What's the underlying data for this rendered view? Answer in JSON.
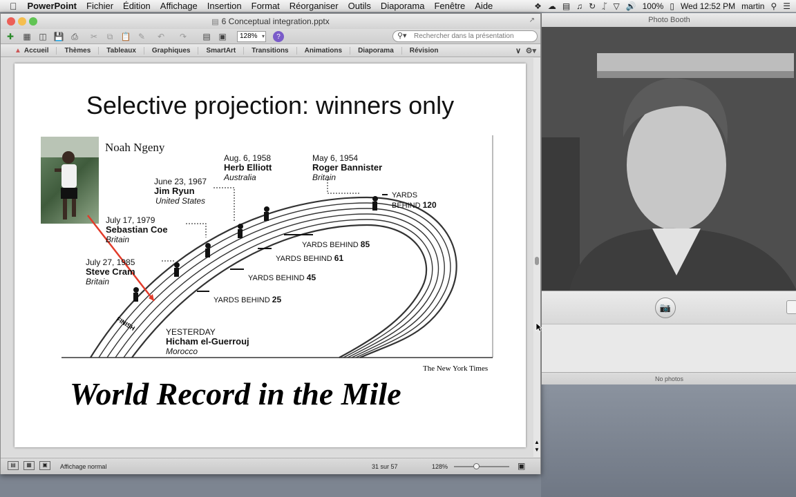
{
  "menubar": {
    "app": "PowerPoint",
    "items": [
      "Fichier",
      "Édition",
      "Affichage",
      "Insertion",
      "Format",
      "Réorganiser",
      "Outils",
      "Diaporama",
      "Fenêtre",
      "Aide"
    ],
    "battery": "100%",
    "clock": "Wed 12:52 PM",
    "user": "martin"
  },
  "ppt": {
    "window_title": "6 Conceptual integration.pptx",
    "zoom_value": "128%",
    "search_placeholder": "Rechercher dans la présentation",
    "ribbon_tabs": [
      "Accueil",
      "Thèmes",
      "Tableaux",
      "Graphiques",
      "SmartArt",
      "Transitions",
      "Animations",
      "Diaporama",
      "Révision"
    ],
    "slide": {
      "title": "Selective projection: winners only",
      "person_caption": "Noah Ngeny",
      "runners": [
        {
          "date": "Aug. 6, 1958",
          "name": "Herb Elliott",
          "country": "Australia"
        },
        {
          "date": "May 6, 1954",
          "name": "Roger Bannister",
          "country": "Britain"
        },
        {
          "date": "June 23, 1967",
          "name": "Jim Ryun",
          "country": "United States"
        },
        {
          "date": "July 17, 1979",
          "name": "Sebastian Coe",
          "country": "Britain"
        },
        {
          "date": "July 27, 1985",
          "name": "Steve Cram",
          "country": "Britain"
        },
        {
          "date": "YESTERDAY",
          "name": "Hicham el-Guerrouj",
          "country": "Morocco"
        }
      ],
      "yards": [
        {
          "label": "YARDS",
          "label2": "BEHIND",
          "value": "120"
        },
        {
          "label": "YARDS BEHIND",
          "value": "85"
        },
        {
          "label": "YARDS BEHIND",
          "value": "61"
        },
        {
          "label": "YARDS BEHIND",
          "value": "45"
        },
        {
          "label": "YARDS BEHIND",
          "value": "25"
        }
      ],
      "finish": "FINISH",
      "credit": "The New York Times",
      "headline": "World Record in the Mile"
    },
    "status": {
      "view": "Affichage normal",
      "slide_count": "31 sur 57",
      "zoom": "128%",
      "zoom_level_fraction": 0.4
    }
  },
  "photobooth": {
    "window_title": "Photo Booth",
    "no_photos": "No photos"
  },
  "colors": {
    "accent_red": "#e23b2a",
    "close": "#ec5f57",
    "min": "#f5be4f",
    "max": "#61c454"
  }
}
